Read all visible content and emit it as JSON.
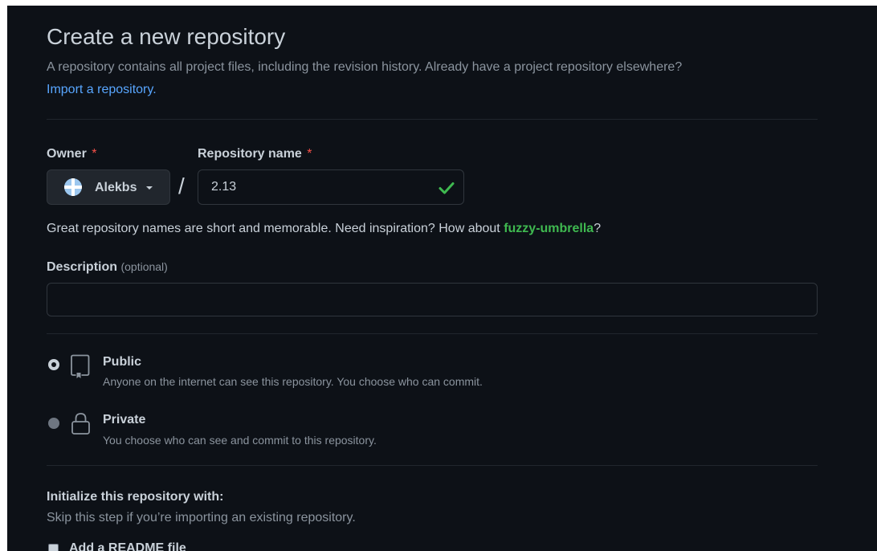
{
  "header": {
    "title": "Create a new repository",
    "subtitle": "A repository contains all project files, including the revision history. Already have a project repository elsewhere?",
    "import_link": "Import a repository."
  },
  "owner": {
    "label": "Owner",
    "required_mark": "*",
    "selected": "Alekbs"
  },
  "repo": {
    "label": "Repository name",
    "required_mark": "*",
    "value": "2.13",
    "separator": "/"
  },
  "hint": {
    "text": "Great repository names are short and memorable. Need inspiration? How about ",
    "suggestion": "fuzzy-umbrella",
    "end": "?"
  },
  "description": {
    "label": "Description",
    "optional": "(optional)",
    "value": ""
  },
  "visibility": {
    "selected": "public",
    "public": {
      "title": "Public",
      "desc": "Anyone on the internet can see this repository. You choose who can commit."
    },
    "private": {
      "title": "Private",
      "desc": "You choose who can see and commit to this repository."
    }
  },
  "init": {
    "title": "Initialize this repository with:",
    "subtitle": "Skip this step if you’re importing an existing repository.",
    "readme_label": "Add a README file"
  },
  "colors": {
    "background": "#0d1117",
    "link": "#58a6ff",
    "success": "#3fb950",
    "danger": "#f85149",
    "text": "#c9d1d9",
    "muted": "#8b949e"
  },
  "icons": {
    "avatar": "avatar-icon",
    "owner_caret": "caret-down-icon",
    "repo_valid": "check-icon",
    "public": "repo-icon",
    "private": "lock-icon"
  }
}
